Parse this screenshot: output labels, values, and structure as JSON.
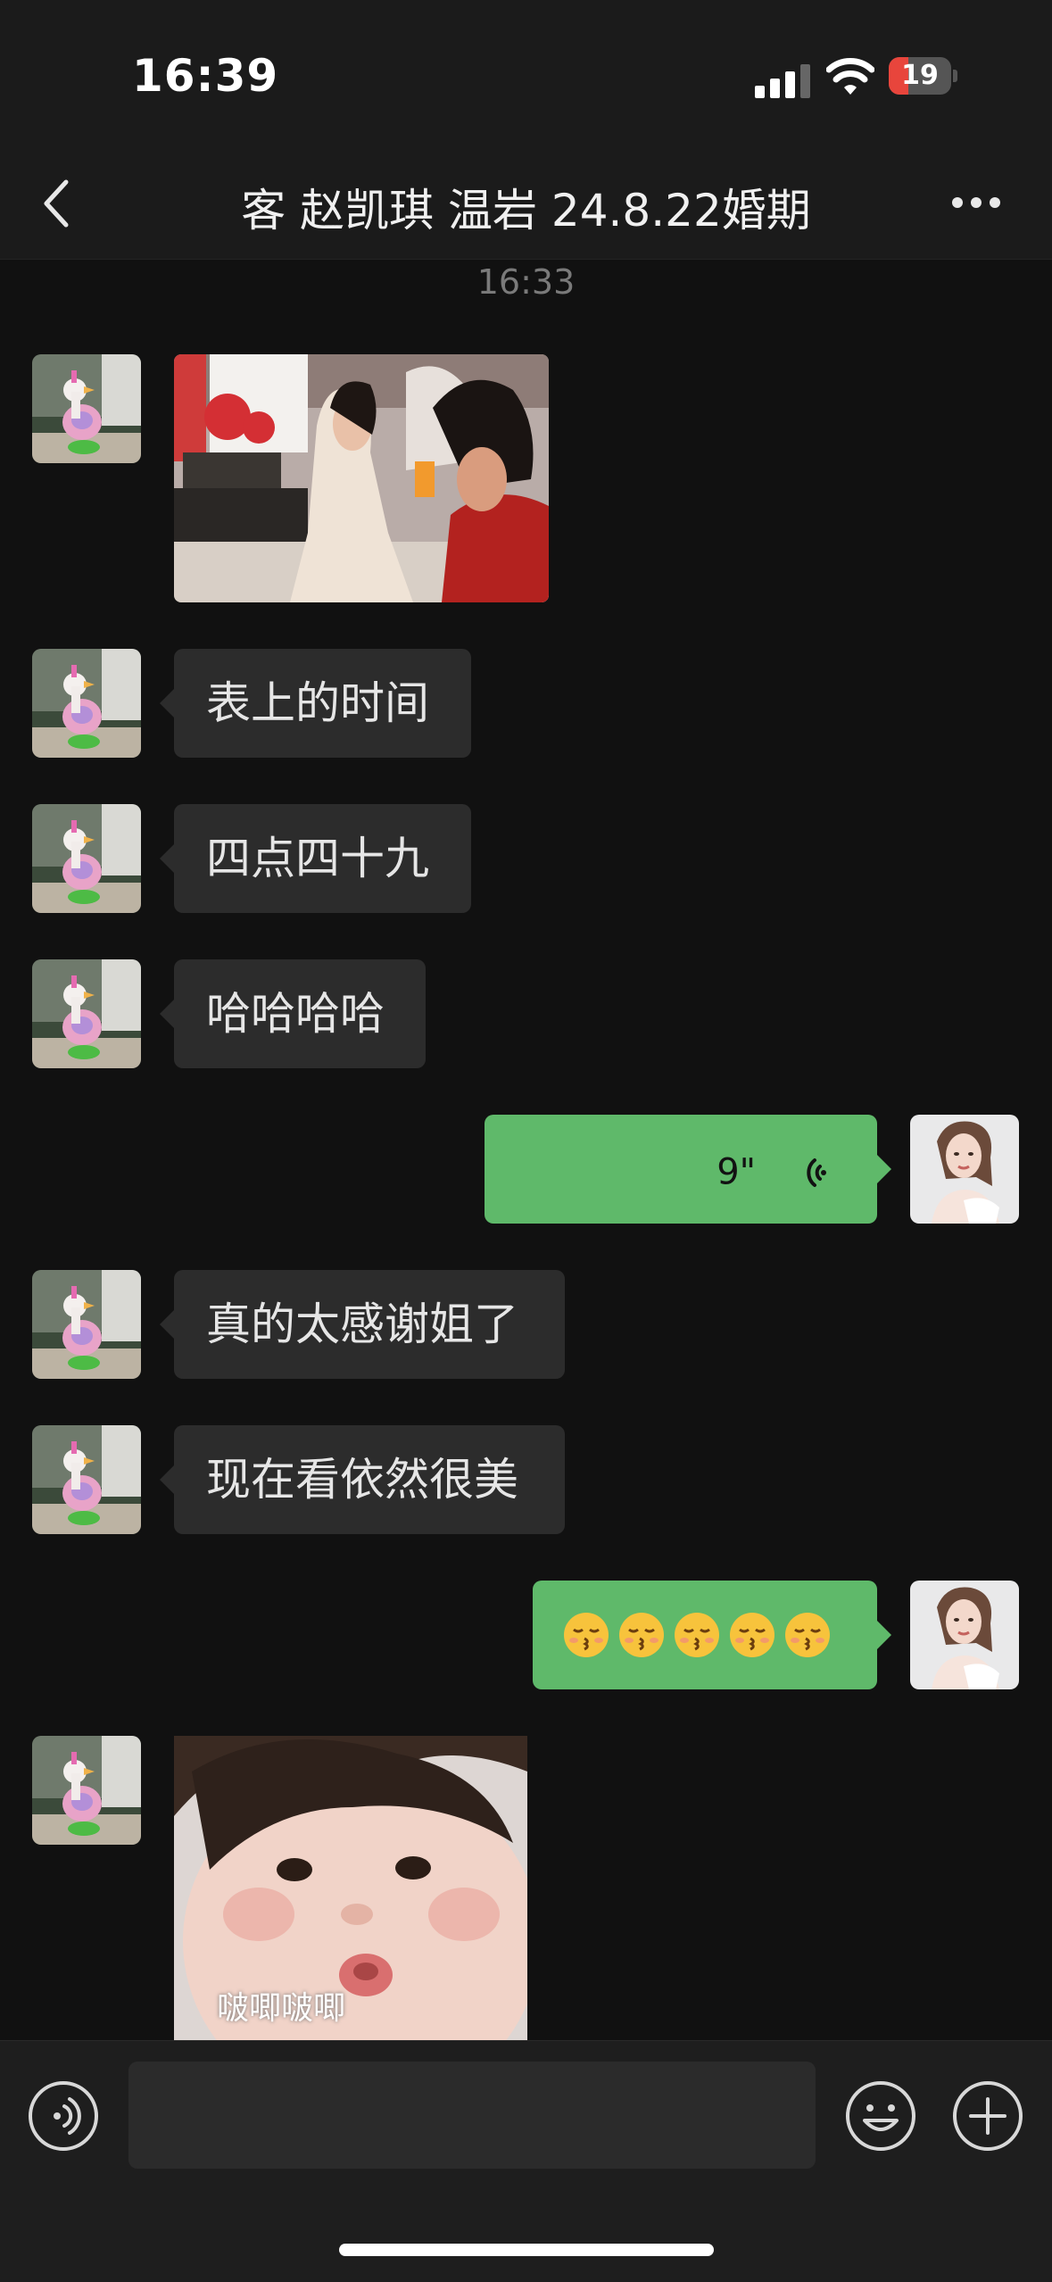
{
  "status_bar": {
    "time": "16:39",
    "battery": "19"
  },
  "header": {
    "title": "客 赵凯琪  温岩 24.8.22婚期"
  },
  "chat": {
    "timestamp": "16:33",
    "messages": [
      {
        "type": "image",
        "direction": "incoming"
      },
      {
        "type": "text",
        "direction": "incoming",
        "text": "表上的时间"
      },
      {
        "type": "text",
        "direction": "incoming",
        "text": "四点四十九"
      },
      {
        "type": "text",
        "direction": "incoming",
        "text": "哈哈哈哈"
      },
      {
        "type": "voice",
        "direction": "outgoing",
        "duration": "9\""
      },
      {
        "type": "text",
        "direction": "incoming",
        "text": "真的太感谢姐了"
      },
      {
        "type": "text",
        "direction": "incoming",
        "text": "现在看依然很美"
      },
      {
        "type": "emoji",
        "direction": "outgoing",
        "emoji_count": 5
      },
      {
        "type": "sticker",
        "direction": "incoming",
        "caption": "啵唧啵唧"
      }
    ]
  },
  "input_bar": {
    "voice_icon": "voice-toggle-icon",
    "emoji_icon": "smiley-icon",
    "plus_icon": "plus-icon"
  },
  "colors": {
    "outgoing_bubble": "#5fb96a",
    "incoming_bubble": "#2c2c2c",
    "background": "#111111",
    "battery_low": "#e8453c"
  }
}
